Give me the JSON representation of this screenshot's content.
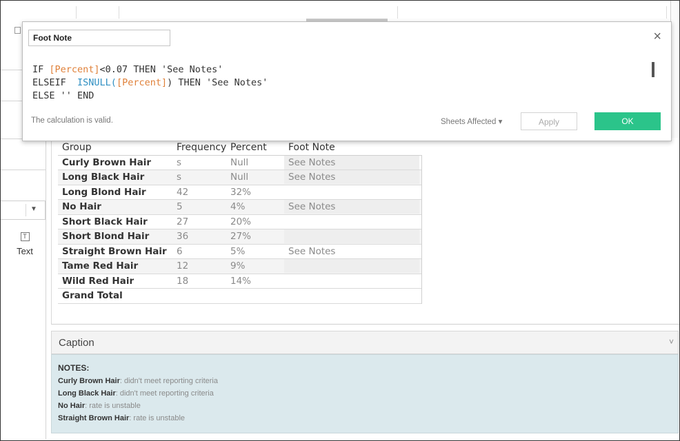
{
  "dialog": {
    "name_value": "Foot Note",
    "code_lines": [
      {
        "kw1": "IF ",
        "fld1": "[Percent]",
        "rest": "<0.07 THEN 'See Notes'"
      },
      {
        "kw1": "ELSEIF  ",
        "fn": "ISNULL(",
        "fld1": "[Percent]",
        "rest": ") THEN 'See Notes'"
      },
      {
        "kw1": "ELSE '' END"
      }
    ],
    "status": "The calculation is valid.",
    "sheets_affected": "Sheets Affected",
    "apply": "Apply",
    "ok": "OK",
    "close": "×"
  },
  "sidebar": {
    "text_label": "Text",
    "text_icon": "T"
  },
  "table": {
    "headers": {
      "group": "Group",
      "frequency": "Frequency",
      "percent": "Percent",
      "foot_note": "Foot Note"
    },
    "rows": [
      {
        "group": "Curly Brown Hair",
        "frequency": "s",
        "percent": "Null",
        "foot_note": "See Notes"
      },
      {
        "group": "Long Black Hair",
        "frequency": "s",
        "percent": "Null",
        "foot_note": "See Notes"
      },
      {
        "group": "Long Blond Hair",
        "frequency": "42",
        "percent": "32%",
        "foot_note": ""
      },
      {
        "group": "No Hair",
        "frequency": "5",
        "percent": "4%",
        "foot_note": "See Notes"
      },
      {
        "group": "Short Black Hair",
        "frequency": "27",
        "percent": "20%",
        "foot_note": ""
      },
      {
        "group": "Short Blond Hair",
        "frequency": "36",
        "percent": "27%",
        "foot_note": ""
      },
      {
        "group": "Straight Brown Hair",
        "frequency": "6",
        "percent": "5%",
        "foot_note": "See Notes"
      },
      {
        "group": "Tame Red Hair",
        "frequency": "12",
        "percent": "9%",
        "foot_note": ""
      },
      {
        "group": "Wild Red Hair",
        "frequency": "18",
        "percent": "14%",
        "foot_note": ""
      },
      {
        "group": "Grand Total",
        "frequency": "",
        "percent": "",
        "foot_note": ""
      }
    ]
  },
  "caption": {
    "header": "Caption",
    "title": "NOTES:",
    "lines": [
      {
        "bold": "Curly Brown Hair",
        "text": ": didn't meet reporting criteria"
      },
      {
        "bold": "Long Black Hair",
        "text": ": didn't meet reporting criteria"
      },
      {
        "bold": "No Hair",
        "text": ": rate is unstable"
      },
      {
        "bold": "Straight Brown Hair",
        "text": ": rate is unstable"
      }
    ]
  },
  "colors": {
    "field": "#e0813a",
    "function": "#2f8fc2",
    "ok_button": "#2bc48a",
    "caption_bg": "#dbe9ed"
  }
}
